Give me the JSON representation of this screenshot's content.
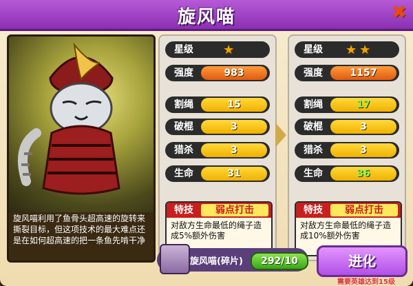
{
  "window": {
    "title": "旋风喵"
  },
  "hero": {
    "description": "旋风喵利用了鱼骨头超高速的旋转来撕裂目标，但这项技术的最大难点还是在如何超高速的把一条鱼先啃干净"
  },
  "stats_current": {
    "star_label": "星级",
    "stars": 1,
    "power_label": "强度",
    "power": "983",
    "cut_label": "割绳",
    "cut": "15",
    "break_label": "破棍",
    "break": "3",
    "hunt_label": "猎杀",
    "hunt": "3",
    "life_label": "生命",
    "life": "31",
    "skill_tag": "特技",
    "skill_name": "弱点打击",
    "skill_text": "对敌方生命最低的绳子造成5%额外伤害"
  },
  "stats_next": {
    "star_label": "星级",
    "stars": 2,
    "power_label": "强度",
    "power": "1157",
    "cut_label": "割绳",
    "cut": "17",
    "break_label": "破棍",
    "break": "3",
    "hunt_label": "猎杀",
    "hunt": "3",
    "life_label": "生命",
    "life": "36",
    "skill_tag": "特技",
    "skill_name": "弱点打击",
    "skill_text": "对敌方生命最低的绳子造成10%额外伤害"
  },
  "bottom": {
    "shard_name": "旋风喵(碎片)",
    "shard_progress": "292/10",
    "evolve_label": "进化",
    "hint": "需要英雄达到15级"
  }
}
